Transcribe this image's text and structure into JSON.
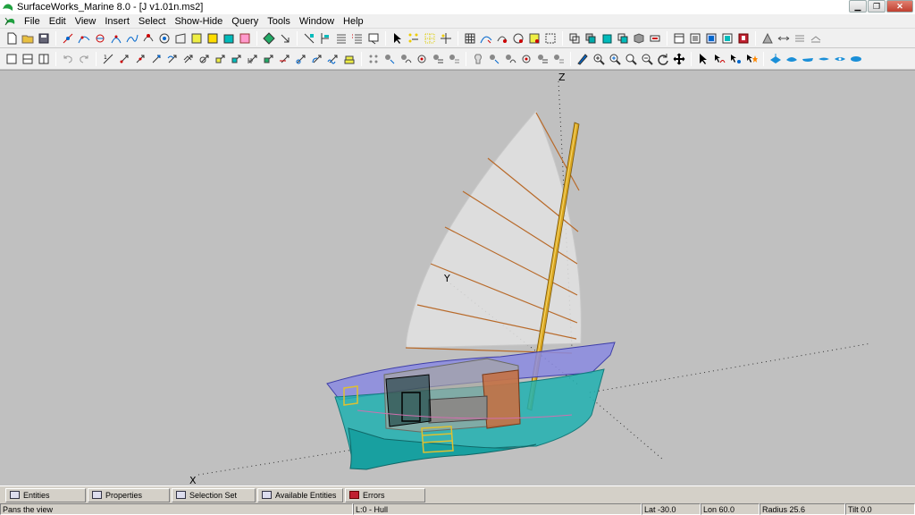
{
  "window": {
    "title": "SurfaceWorks_Marine 8.0 - [J v1.01n.ms2]",
    "minimize": "0",
    "restore": "1",
    "close": "r"
  },
  "menu": [
    "File",
    "Edit",
    "View",
    "Insert",
    "Select",
    "Show-Hide",
    "Query",
    "Tools",
    "Window",
    "Help"
  ],
  "viewport": {
    "axis_z": "Z",
    "axis_y": "Y",
    "axis_x": "X",
    "colors": {
      "background": "#c0c0c0",
      "hull": "#1aaaa8",
      "deck": "#7a7ad8",
      "sail": "#e0e0e0",
      "battens": "#c07a30",
      "mast": "#d4a020"
    }
  },
  "tabs": [
    {
      "label": "Entities",
      "icon": "entities-icon"
    },
    {
      "label": "Properties",
      "icon": "properties-icon"
    },
    {
      "label": "Selection Set",
      "icon": "selection-set-icon"
    },
    {
      "label": "Available Entities",
      "icon": "available-entities-icon"
    },
    {
      "label": "Errors",
      "icon": "errors-icon"
    }
  ],
  "status": {
    "hint": "Pans the view",
    "layer": "L:0 - Hull",
    "lat": "Lat -30.0",
    "lon": "Lon 60.0",
    "radius": "Radius 25.6",
    "tilt": "Tilt 0.0"
  }
}
